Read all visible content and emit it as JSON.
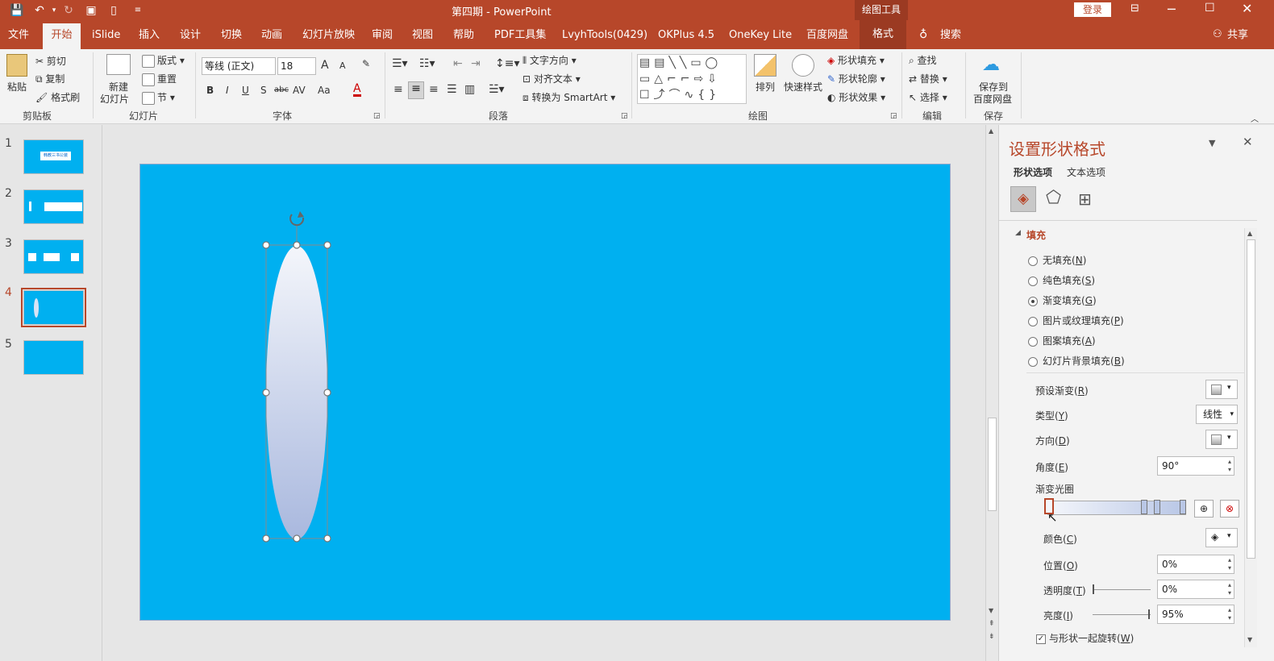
{
  "window": {
    "title": "第四期  -  PowerPoint",
    "drawing_tools": "绘图工具",
    "login": "登录",
    "qat_icons": [
      "save-icon",
      "undo-icon",
      "redo-icon",
      "present-icon",
      "new-icon",
      "customize-icon"
    ]
  },
  "tabs": {
    "file": "文件",
    "home": "开始",
    "islide": "iSlide",
    "insert": "插入",
    "design": "设计",
    "transitions": "切换",
    "animations": "动画",
    "slideshow": "幻灯片放映",
    "review": "审阅",
    "view": "视图",
    "help": "帮助",
    "pdf": "PDF工具集",
    "lvyh": "LvyhTools(0429)",
    "okplus": "OKPlus 4.5",
    "onekey": "OneKey Lite",
    "baidu": "百度网盘",
    "format": "格式",
    "search": "搜索",
    "share": "共享"
  },
  "ribbon": {
    "clipboard": {
      "paste": "粘贴",
      "cut": "剪切",
      "copy": "复制",
      "painter": "格式刷",
      "label": "剪贴板"
    },
    "slides": {
      "new_slide_1": "新建",
      "new_slide_2": "幻灯片",
      "layout": "版式",
      "reset": "重置",
      "section": "节",
      "label": "幻灯片"
    },
    "font": {
      "name": "等线 (正文)",
      "size": "18",
      "label": "字体",
      "bold": "B",
      "italic": "I",
      "underline": "U",
      "shadow": "S",
      "strike": "abc",
      "spacing": "AV",
      "case": "Aa",
      "color": "A",
      "grow": "A",
      "shrink": "A"
    },
    "paragraph": {
      "text_direction": "文字方向",
      "align_text": "对齐文本",
      "smartart": "转换为 SmartArt",
      "label": "段落"
    },
    "drawing": {
      "arrange": "排列",
      "quick_styles": "快速样式",
      "shape_fill": "形状填充",
      "shape_outline": "形状轮廓",
      "shape_effects": "形状效果",
      "label": "绘图"
    },
    "editing": {
      "find": "查找",
      "replace": "替换",
      "select": "选择",
      "label": "编辑"
    },
    "save": {
      "save_to_1": "保存到",
      "save_to_2": "百度网盘",
      "label": "保存"
    }
  },
  "thumbnails": [
    {
      "num": "1",
      "caption": "韩教三书公装"
    },
    {
      "num": "2"
    },
    {
      "num": "3"
    },
    {
      "num": "4",
      "selected": true
    },
    {
      "num": "5"
    }
  ],
  "slide": {
    "background": "#00b0f0"
  },
  "panel": {
    "title": "设置形状格式",
    "tab_shape": "形状选项",
    "tab_text": "文本选项",
    "section_fill": "填充",
    "fill_options": [
      {
        "text": "无填充",
        "key": "N"
      },
      {
        "text": "纯色填充",
        "key": "S"
      },
      {
        "text": "渐变填充",
        "key": "G"
      },
      {
        "text": "图片或纹理填充",
        "key": "P"
      },
      {
        "text": "图案填充",
        "key": "A"
      },
      {
        "text": "幻灯片背景填充",
        "key": "B"
      }
    ],
    "selected_fill": "渐变填充",
    "preset": {
      "text": "预设渐变",
      "key": "R"
    },
    "type": {
      "text": "类型",
      "key": "Y",
      "value": "线性"
    },
    "direction": {
      "text": "方向",
      "key": "D"
    },
    "angle": {
      "text": "角度",
      "key": "E",
      "value": "90°"
    },
    "gradient_stops_label": "渐变光圈",
    "color": {
      "text": "颜色",
      "key": "C"
    },
    "position": {
      "text": "位置",
      "key": "O",
      "value": "0%"
    },
    "transparency": {
      "text": "透明度",
      "key": "T",
      "value": "0%"
    },
    "brightness": {
      "text": "亮度",
      "key": "I",
      "value": "95%"
    },
    "rotate": {
      "text": "与形状一起旋转",
      "key": "W"
    }
  }
}
